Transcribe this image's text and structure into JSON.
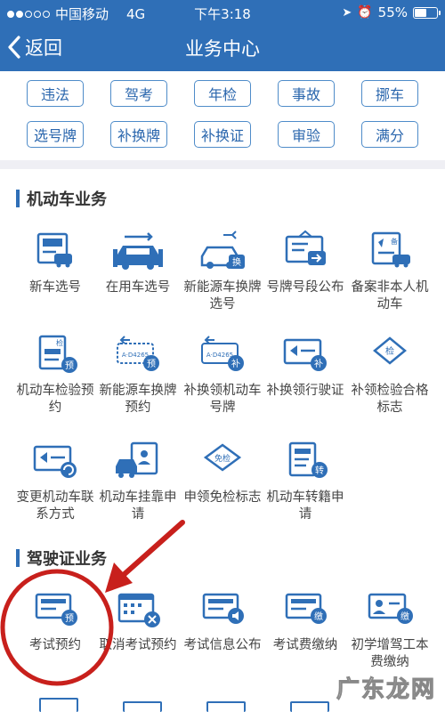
{
  "status_bar": {
    "carrier": "中国移动",
    "network": "4G",
    "time": "下午3:18",
    "battery": "55%",
    "battery_level": 0.55
  },
  "nav": {
    "back_label": "返回",
    "title": "业务中心"
  },
  "tags": [
    "违法",
    "驾考",
    "年检",
    "事故",
    "挪车",
    "选号牌",
    "补换牌",
    "补换证",
    "审验",
    "满分"
  ],
  "sections": {
    "vehicle": {
      "title": "机动车业务",
      "items": [
        "新车选号",
        "在用车选号",
        "新能源车换牌选号",
        "号牌号段公布",
        "备案非本人机动车",
        "机动车检验预约",
        "新能源车换牌预约",
        "补换领机动车号牌",
        "补换领行驶证",
        "补领检验合格标志",
        "变更机动车联系方式",
        "机动车挂靠申请",
        "申领免检标志",
        "机动车转籍申请"
      ]
    },
    "license": {
      "title": "驾驶证业务",
      "items": [
        "考试预约",
        "取消考试预约",
        "考试信息公布",
        "考试费缴纳",
        "初学增驾工本费缴纳"
      ]
    }
  },
  "badges": {
    "pre": "预",
    "replace": "补",
    "exchange": "换",
    "transfer": "转",
    "inspect": "检",
    "exempt": "免检",
    "pay": "缴",
    "record": "备"
  },
  "watermark": "广东龙网",
  "colors": {
    "primary": "#2f6fb7",
    "accent": "#e2302c",
    "bg": "#ffffff"
  }
}
